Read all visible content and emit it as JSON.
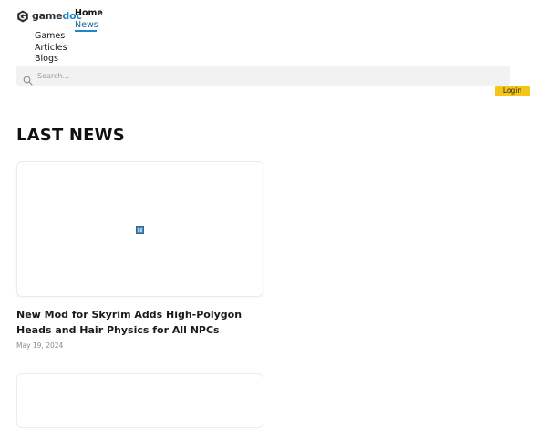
{
  "brand": {
    "name_part1": "game",
    "name_part2": "doc",
    "icon": "gamedoc-logo-icon",
    "colors": {
      "dark": "#2b2f36",
      "accent": "#1f86c8"
    }
  },
  "nav": {
    "primary": [
      {
        "label": "Home"
      },
      {
        "label": "News",
        "active": true
      }
    ],
    "secondary": [
      {
        "label": "Games"
      },
      {
        "label": "Articles"
      },
      {
        "label": "Blogs"
      }
    ]
  },
  "search": {
    "placeholder": "Search...",
    "value": "",
    "icon": "search-icon"
  },
  "login": {
    "label": "Login",
    "color": "#f5c518"
  },
  "section": {
    "title": "LAST NEWS"
  },
  "articles": [
    {
      "title": "New Mod for Skyrim Adds High-Polygon Heads and Hair Physics for All NPCs",
      "date": "May 19, 2024",
      "image_icon": "broken-image-icon"
    }
  ]
}
